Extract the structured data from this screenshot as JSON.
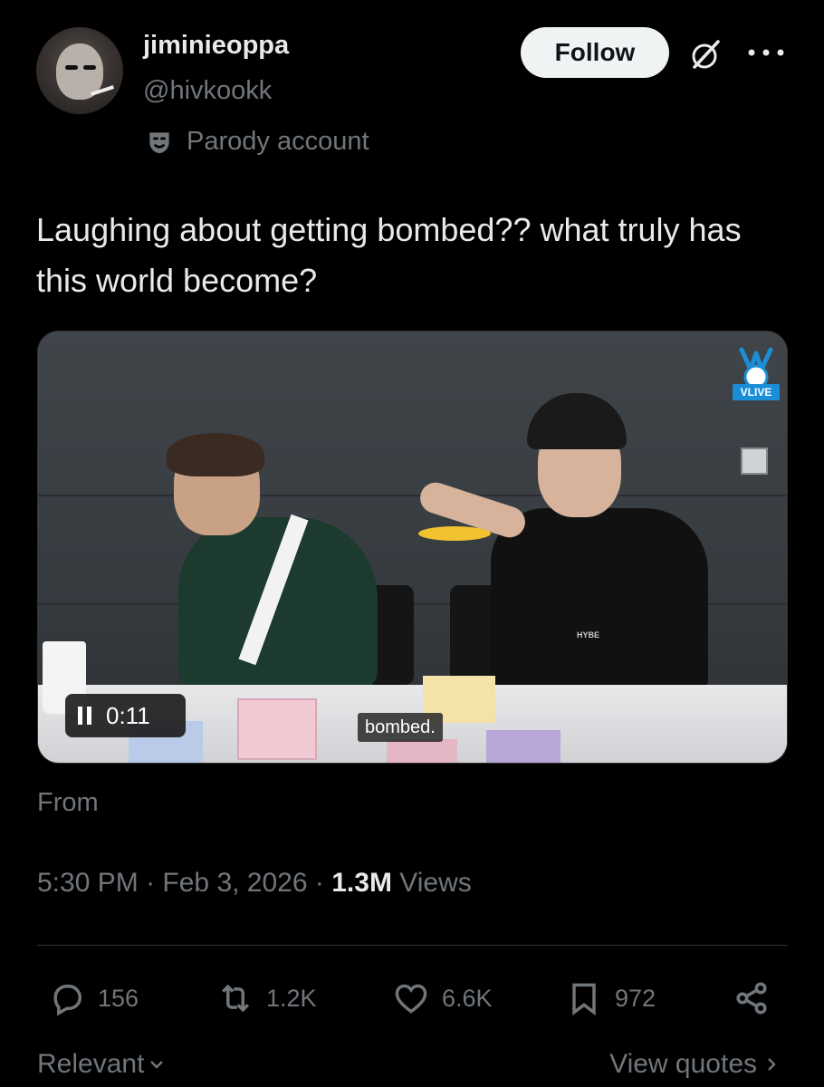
{
  "author": {
    "display_name": "jiminieoppa",
    "handle": "@hivkookk",
    "label": "Parody account"
  },
  "header_actions": {
    "follow_label": "Follow"
  },
  "tweet": {
    "text": "Laughing about getting bombed?? what truly has this world become?"
  },
  "video": {
    "timestamp": "0:11",
    "subtitle": "bombed.",
    "watermark": "VLIVE",
    "shirt_text": "HYBE"
  },
  "source": {
    "from_label": "From"
  },
  "meta": {
    "time": "5:30 PM",
    "date": "Feb 3, 2026",
    "views_count": "1.3M",
    "views_label": "Views",
    "separator": "·"
  },
  "actions": {
    "replies": "156",
    "reposts": "1.2K",
    "likes": "6.6K",
    "bookmarks": "972"
  },
  "footer": {
    "relevant_label": "Relevant",
    "view_quotes_label": "View quotes"
  },
  "colors": {
    "background": "#000000",
    "text_primary": "#e7e9ea",
    "text_secondary": "#71767b",
    "follow_bg": "#eff3f4",
    "divider": "#2f3336"
  }
}
